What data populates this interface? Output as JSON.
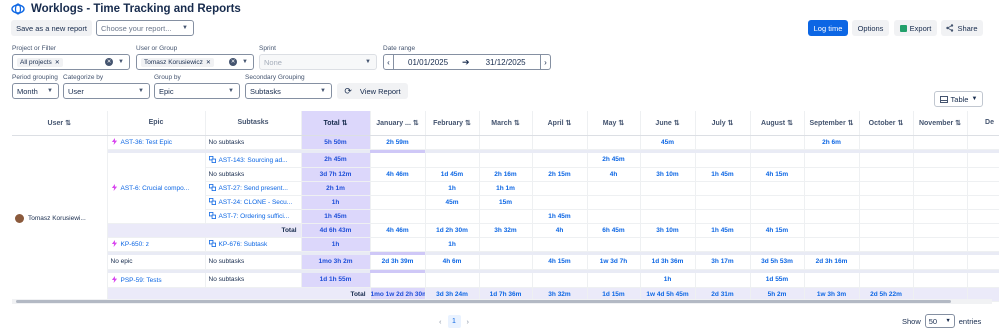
{
  "header": {
    "title": "Worklogs - Time Tracking and Reports"
  },
  "toolbar": {
    "save_report": "Save as a new report",
    "choose_report_placeholder": "Choose your report...",
    "log_time": "Log time",
    "options": "Options",
    "export": "Export",
    "share": "Share"
  },
  "filters": {
    "project_label": "Project or Filter",
    "project_tag": "All projects",
    "user_label": "User or Group",
    "user_tag": "Tomasz Korusiewicz",
    "sprint_label": "Sprint",
    "sprint_placeholder": "None",
    "date_label": "Date range",
    "date_from": "01/01/2025",
    "date_to": "31/12/2025",
    "period_label": "Period grouping",
    "period_value": "Month",
    "categorize_label": "Categorize by",
    "categorize_value": "User",
    "groupby_label": "Group by",
    "groupby_value": "Epic",
    "secondary_label": "Secondary Grouping",
    "secondary_value": "Subtasks",
    "view_report": "View Report",
    "view_mode": "Table"
  },
  "table": {
    "headers": [
      "User",
      "Epic",
      "Subtasks",
      "Total",
      "January ...",
      "February",
      "March",
      "April",
      "May",
      "June",
      "July",
      "August",
      "September",
      "October",
      "November",
      "De"
    ],
    "user": "Tomasz Korusiewi...",
    "epics": {
      "ast36": "AST-36: Test Epic",
      "ast6": "AST-6: Crucial compo...",
      "kp650": "KP-650: z",
      "noepic": "No epic",
      "psp59": "PSP-59: Tests"
    },
    "rows": [
      {
        "sub": "No subtasks",
        "vals": [
          "5h 50m",
          "2h 59m",
          "",
          "",
          "",
          "",
          "45m",
          "",
          "",
          "2h 6m",
          "",
          "",
          ""
        ]
      },
      {
        "sub": "AST-143: Sourcing ad...",
        "vals": [
          "2h 45m",
          "",
          "",
          "",
          "",
          "2h 45m",
          "",
          "",
          "",
          "",
          "",
          "",
          ""
        ]
      },
      {
        "sub": "No subtasks",
        "vals": [
          "3d 7h 12m",
          "4h 46m",
          "1d 45m",
          "2h 16m",
          "2h 15m",
          "4h",
          "3h 10m",
          "1h 45m",
          "4h 15m",
          "",
          "",
          "",
          ""
        ]
      },
      {
        "sub": "AST-27: Send present...",
        "vals": [
          "2h 1m",
          "",
          "1h",
          "1h 1m",
          "",
          "",
          "",
          "",
          "",
          "",
          "",
          "",
          ""
        ]
      },
      {
        "sub": "AST-24: CLONE - Secu...",
        "vals": [
          "1h",
          "",
          "45m",
          "15m",
          "",
          "",
          "",
          "",
          "",
          "",
          "",
          "",
          ""
        ]
      },
      {
        "sub": "AST-7: Ordering suffici...",
        "vals": [
          "1h 45m",
          "",
          "",
          "",
          "1h 45m",
          "",
          "",
          "",
          "",
          "",
          "",
          "",
          ""
        ]
      },
      {
        "sub": "Total",
        "vals": [
          "4d 6h 43m",
          "4h 46m",
          "1d 2h 30m",
          "3h 32m",
          "4h",
          "6h 45m",
          "3h 10m",
          "1h 45m",
          "4h 15m",
          "",
          "",
          "",
          ""
        ]
      },
      {
        "sub": "KP-676: Subtask",
        "vals": [
          "1h",
          "",
          "1h",
          "",
          "",
          "",
          "",
          "",
          "",
          "",
          "",
          "",
          ""
        ]
      },
      {
        "sub": "No subtasks",
        "vals": [
          "1mo 3h 2m",
          "2d 3h 39m",
          "4h 6m",
          "",
          "4h 15m",
          "1w 3d 7h",
          "1d 3h 36m",
          "3h 17m",
          "3d 5h 53m",
          "2d 3h 16m",
          "",
          "",
          ""
        ]
      },
      {
        "sub": "No subtasks",
        "vals": [
          "1d 1h 55m",
          "",
          "",
          "",
          "",
          "",
          "1h",
          "",
          "1d 55m",
          "",
          "",
          "",
          ""
        ]
      },
      {
        "sub": "Total",
        "vals": [
          "1mo 1w 2d 2h 30m",
          "3d 3h 24m",
          "1d 7h 36m",
          "3h 32m",
          "1d 15m",
          "1w 4d 5h 45m",
          "2d 31m",
          "5h 2m",
          "1w 3h 3m",
          "2d 5h 22m",
          "",
          "",
          ""
        ]
      }
    ]
  },
  "pagination": {
    "page": "1",
    "show_label": "Show",
    "entries_value": "50",
    "entries_label": "entries"
  },
  "colors": {
    "accent": "#0c66e4",
    "total_col": "#dcd7fb"
  }
}
